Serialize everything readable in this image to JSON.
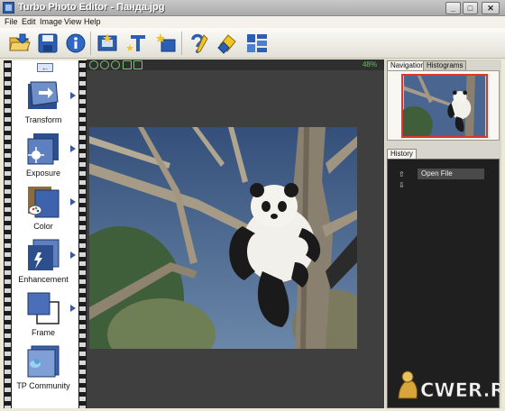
{
  "window": {
    "title": "Turbo Photo Editor  - Панда.jpg"
  },
  "titlebar_buttons": {
    "minimize": "_",
    "maximize": "□",
    "close": "✕"
  },
  "menu": [
    "File",
    "Edit",
    "Image",
    "View",
    "Help"
  ],
  "toolbar": {
    "buttons": [
      "open-icon",
      "save-icon",
      "info-icon",
      "add-frame-icon",
      "add-text-icon",
      "add-clipart-icon",
      "help-wizard-icon",
      "batch-icon",
      "gallery-icon"
    ]
  },
  "sidebar": {
    "back_label": "←",
    "tools": [
      {
        "label": "Transform"
      },
      {
        "label": "Exposure"
      },
      {
        "label": "Color"
      },
      {
        "label": "Enhancement"
      },
      {
        "label": "Frame"
      },
      {
        "label": "TP Community"
      }
    ]
  },
  "canvas": {
    "zoom": "48%"
  },
  "right": {
    "tabs": [
      "Navigation",
      "Histograms"
    ],
    "history_tab": "History",
    "history_items": [
      "Open File"
    ]
  },
  "watermark": {
    "text": "CWER.RU"
  },
  "colors": {
    "accent": "#3a5a9a",
    "zoom_text": "#4ecb4e",
    "nav_frame": "#e0352a"
  }
}
